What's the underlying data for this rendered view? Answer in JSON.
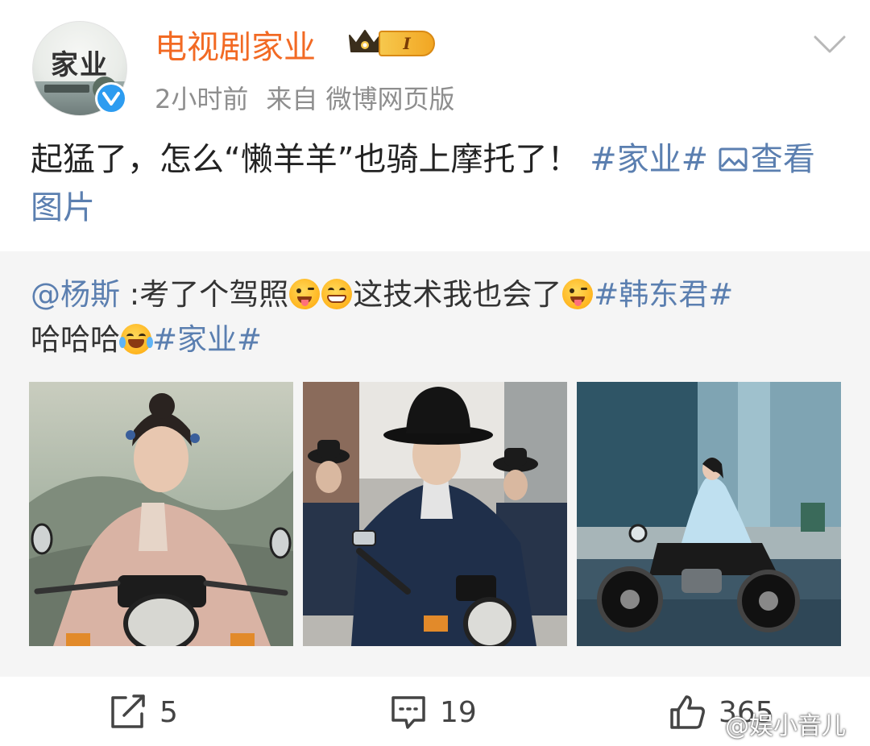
{
  "header": {
    "avatar_text": "家业",
    "username": "电视剧家业",
    "vip_level": "I",
    "time": "2小时前",
    "source": "来自 微博网页版"
  },
  "post": {
    "text": "起猛了，怎么“懒羊羊”也骑上摩托了！",
    "tag": "#家业#",
    "pic_link_line1": "查",
    "pic_link_line2": "看图片"
  },
  "repost": {
    "mention": "@杨斯",
    "text_a": " :考了个驾照",
    "text_b": "这技术我也会了",
    "tag1": "#韩东君#",
    "text_c": "哈哈哈",
    "tag2": "#家业#"
  },
  "photos": [
    {
      "name": "photo-woman-pink-motorcycle"
    },
    {
      "name": "photo-man-black-hat-motorcycle"
    },
    {
      "name": "photo-woman-blue-motorcycle-street"
    }
  ],
  "actions": {
    "repost_count": "5",
    "comment_count": "19",
    "like_count": "365"
  },
  "watermark": "@娱小音儿",
  "icons": {
    "more": "chevron-down-icon",
    "repost": "share-icon",
    "comment": "comment-icon",
    "like": "thumbs-up-icon"
  },
  "colors": {
    "username": "#f26a24",
    "link": "#5b7fb0",
    "verified": "#2d9cf0",
    "repost_bg": "#f5f5f5"
  }
}
